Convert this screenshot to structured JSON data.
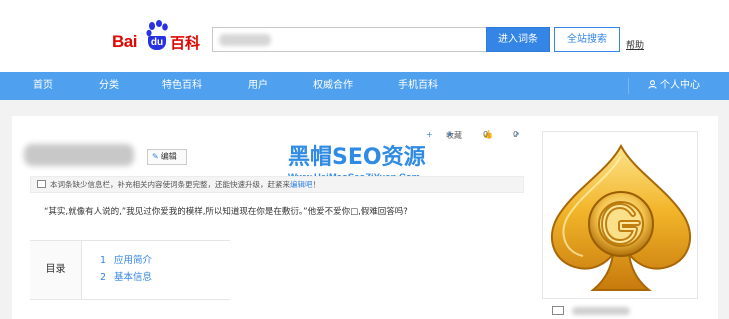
{
  "header": {
    "logo": {
      "bai": "Bai",
      "du": "du",
      "baike": "百科"
    },
    "search": {
      "value": "",
      "placeholder": ""
    },
    "enter_label": "进入词条",
    "site_search_label": "全站搜索",
    "help_label": "帮助"
  },
  "nav": {
    "items": [
      "首页",
      "分类",
      "特色百科",
      "用户",
      "权威合作",
      "手机百科"
    ],
    "user_center": "个人中心",
    "background_color": "#4fa0ee"
  },
  "entry": {
    "edit_label": "编辑",
    "actions": {
      "add": "+",
      "favorite": "收藏",
      "like_count": "0",
      "share_count": "0"
    },
    "watermark_main": "黑帽SEO资源",
    "watermark_sub": "Www.HeiMaoSeoZiYuan.Com",
    "notice": "本词条缺少信息栏，补充相关内容使词条更完整，还能快速升级，赶紧来",
    "notice_link": "编辑吧",
    "notice_end": "！",
    "body": "“其实,就像有人说的,”我见过你爱我的模样,所以知道现在你是在敷衍。”他爱不爱你□,假难回答吗?"
  },
  "toc": {
    "label": "目录",
    "items": [
      {
        "num": "1",
        "text": "应用简介"
      },
      {
        "num": "2",
        "text": "基本信息"
      }
    ]
  },
  "colors": {
    "accent": "#3485e6",
    "logo_red": "#e10601",
    "gold": "#f0b020"
  }
}
